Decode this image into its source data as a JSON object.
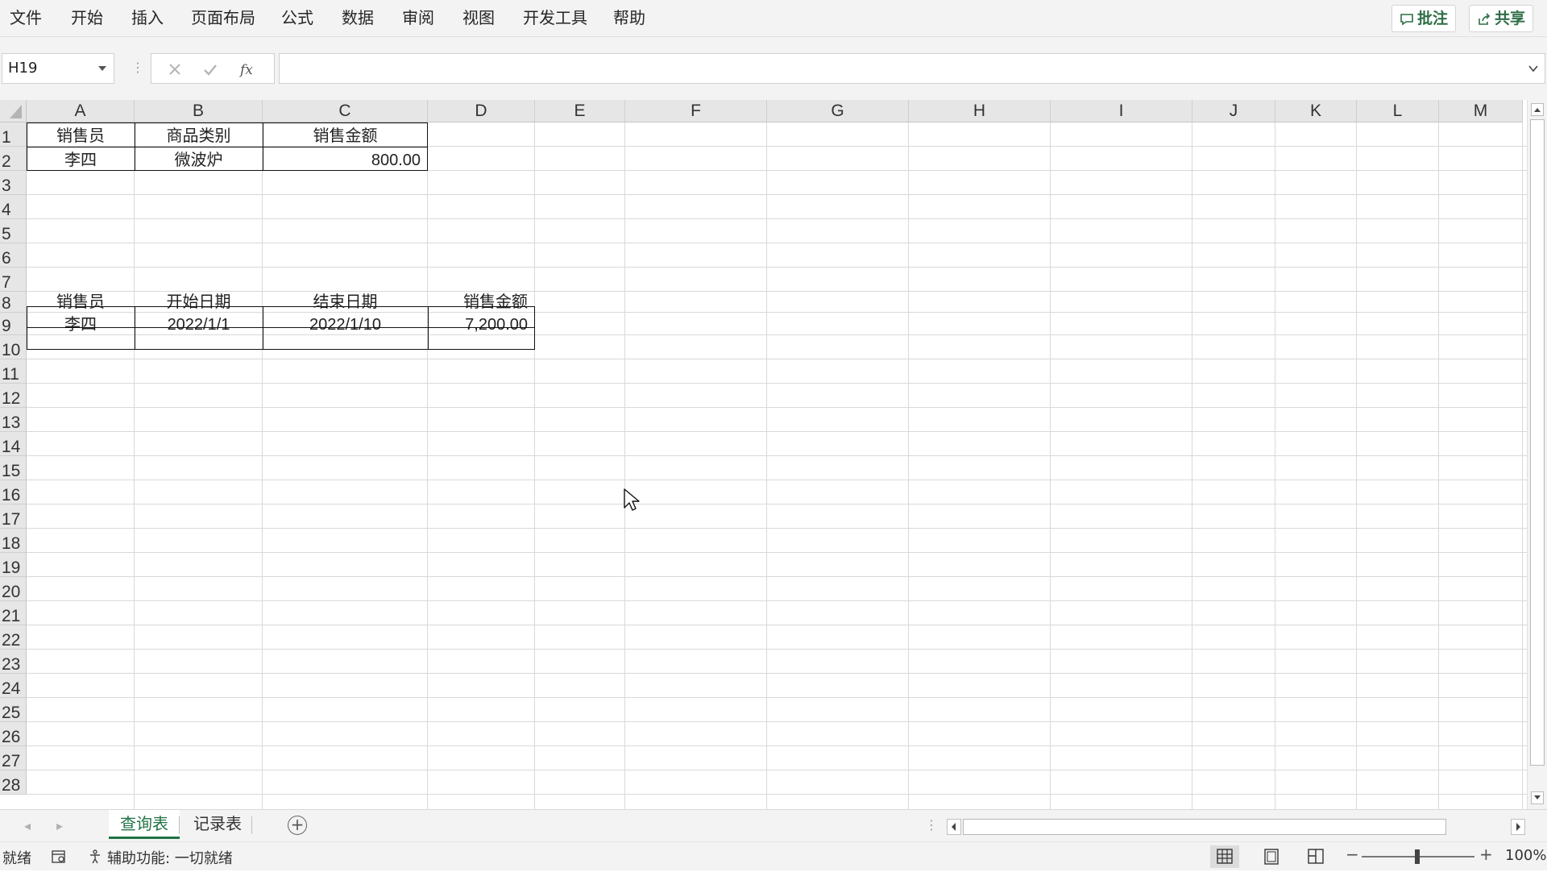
{
  "menu": {
    "items": [
      "文件",
      "开始",
      "插入",
      "页面布局",
      "公式",
      "数据",
      "审阅",
      "视图",
      "开发工具",
      "帮助"
    ],
    "comments_label": "批注",
    "share_label": "共享"
  },
  "formula_bar": {
    "name_box": "H19",
    "formula": ""
  },
  "columns": [
    "A",
    "B",
    "C",
    "D",
    "E",
    "F",
    "G",
    "H",
    "I",
    "J",
    "K",
    "L",
    "M"
  ],
  "rows": [
    "1",
    "2",
    "3",
    "4",
    "5",
    "6",
    "7",
    "8",
    "9",
    "10",
    "11",
    "12",
    "13",
    "14",
    "15",
    "16",
    "17",
    "18",
    "19",
    "20",
    "21",
    "22",
    "23",
    "24",
    "25",
    "26",
    "27",
    "28"
  ],
  "cells": {
    "A1": "销售员",
    "B1": "商品类别",
    "C1": "销售金额",
    "A2": "李四",
    "B2": "微波炉",
    "C2": "800.00",
    "A8": "销售员",
    "B8": "开始日期",
    "C8": "结束日期",
    "D8": "销售金额",
    "A9": "李四",
    "B9": "2022/1/1",
    "C9": "2022/1/10",
    "D9": "7,200.00"
  },
  "sheets": {
    "tabs": [
      "查询表",
      "记录表"
    ],
    "active": "查询表"
  },
  "status": {
    "ready": "就绪",
    "accessibility": "辅助功能: 一切就绪",
    "zoom": "100%"
  },
  "colors": {
    "accent": "#217346",
    "grid_line": "#d9d9d9",
    "header_bg": "#e6e6e6",
    "chrome_bg": "#f3f3f3"
  }
}
